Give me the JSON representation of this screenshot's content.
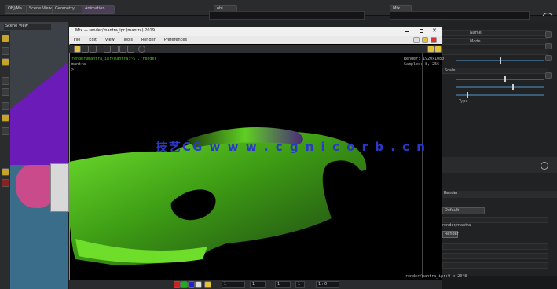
{
  "houdini": {
    "tabs": [
      {
        "label": "OBJ/Ma"
      },
      {
        "label": "Scene View"
      },
      {
        "label": "Geometry"
      },
      {
        "label": "Animation"
      },
      {
        "label": "obj"
      },
      {
        "label": "Mtx"
      }
    ],
    "left_panel_title": "Scene View",
    "right_params": {
      "rows": [
        "Name",
        "Mode",
        "Type",
        "Scale"
      ],
      "bottom_label": "Render",
      "dropdown1": "Default",
      "field_label": "render/mantra",
      "button_label": "Render"
    }
  },
  "render_window": {
    "title": "Mtx — render/mantra_ipr (mantra) 2019",
    "menu": [
      "File",
      "Edit",
      "View",
      "Tools",
      "Render",
      "Preferences"
    ],
    "terminal_lines": [
      "render@mantra_ipr/mantra:~$ ./render",
      "mantra",
      ">"
    ],
    "top_right_info": [
      "Render: 1920x1080",
      "Samples: 8, 256"
    ],
    "bottom_right_info": "render/mantra_ipr:0 x 2048",
    "status_values": [
      "1",
      "1",
      "1",
      "1",
      "1 : 0"
    ]
  },
  "watermark": "技艺CG  w w w . c g n i c o r b . c n",
  "colors": {
    "car_green": "#4fc41c",
    "accent_purple": "#7a2bd1"
  }
}
